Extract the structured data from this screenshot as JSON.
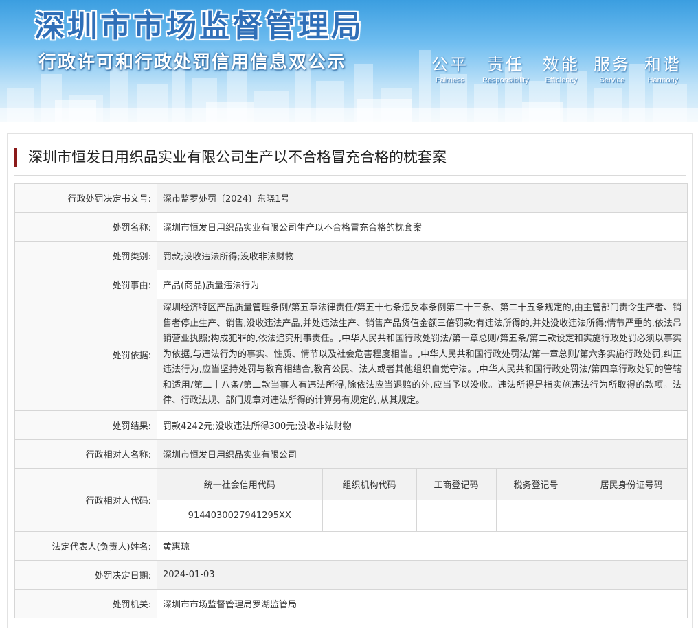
{
  "banner": {
    "title": "深圳市市场监督管理局",
    "subtitle": "行政许可和行政处罚信用信息双公示",
    "motto": [
      {
        "cn": "公平",
        "en": "Fairness"
      },
      {
        "cn": "责任",
        "en": "Responsibility"
      },
      {
        "cn": "效能",
        "en": "Efficiency"
      },
      {
        "cn": "服务",
        "en": "Service"
      },
      {
        "cn": "和谐",
        "en": "Harmony"
      }
    ]
  },
  "case_title": "深圳市恒发日用织品实业有限公司生产以不合格冒充合格的枕套案",
  "fields": {
    "doc_no": {
      "label": "行政处罚决定书文号:",
      "value": "深市监罗处罚〔2024〕东晓1号"
    },
    "name": {
      "label": "处罚名称:",
      "value": "深圳市恒发日用织品实业有限公司生产以不合格冒充合格的枕套案"
    },
    "category": {
      "label": "处罚类别:",
      "value": "罚款;没收违法所得;没收非法财物"
    },
    "cause": {
      "label": "处罚事由:",
      "value": "产品(商品)质量违法行为"
    },
    "basis": {
      "label": "处罚依据:",
      "value": "深圳经济特区产品质量管理条例/第五章法律责任/第五十七条违反本条例第二十三条、第二十五条规定的,由主管部门责令生产者、销售者停止生产、销售,没收违法产品,并处违法生产、销售产品货值金额三倍罚款;有违法所得的,并处没收违法所得;情节严重的,依法吊销营业执照;构成犯罪的,依法追究刑事责任。,中华人民共和国行政处罚法/第一章总则/第五条/第二款设定和实施行政处罚必须以事实为依据,与违法行为的事实、性质、情节以及社会危害程度相当。,中华人民共和国行政处罚法/第一章总则/第六条实施行政处罚,纠正违法行为,应当坚持处罚与教育相结合,教育公民、法人或者其他组织自觉守法。,中华人民共和国行政处罚法/第四章行政处罚的管辖和适用/第二十八条/第二款当事人有违法所得,除依法应当退赔的外,应当予以没收。违法所得是指实施违法行为所取得的款项。法律、行政法规、部门规章对违法所得的计算另有规定的,从其规定。"
    },
    "result": {
      "label": "处罚结果:",
      "value": "罚款4242元;没收违法所得300元;没收非法财物"
    },
    "party_name": {
      "label": "行政相对人名称:",
      "value": "深圳市恒发日用织品实业有限公司"
    },
    "party_code": {
      "label": "行政相对人代码:",
      "headers": [
        "统一社会信用代码",
        "组织机构代码",
        "工商登记码",
        "税务登记号",
        "居民身份证号码"
      ],
      "values": [
        "9144030027941295XX",
        "",
        "",
        "",
        ""
      ]
    },
    "legal_rep": {
      "label": "法定代表人(负责人)姓名:",
      "value": "黄惠琼"
    },
    "date": {
      "label": "处罚决定日期:",
      "value": "2024-01-03"
    },
    "authority": {
      "label": "处罚机关:",
      "value": "深圳市市场监督管理局罗湖监管局"
    }
  }
}
